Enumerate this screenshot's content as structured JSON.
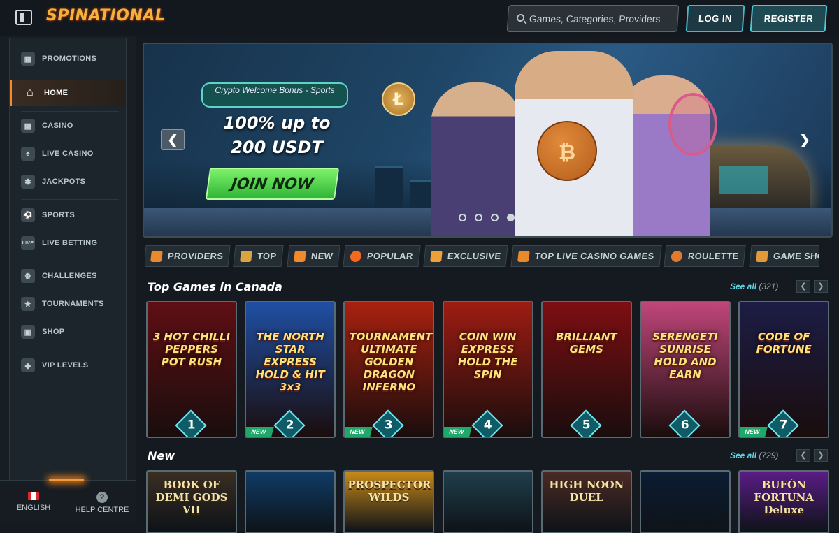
{
  "header": {
    "logo": "SPINATIONAL",
    "search_placeholder": "Games, Categories, Providers",
    "login": "LOG IN",
    "register": "REGISTER"
  },
  "sidebar": {
    "items": [
      {
        "label": "PROMOTIONS",
        "icon": "gift-icon",
        "active": false
      },
      {
        "label": "HOME",
        "icon": "home-icon",
        "active": true
      },
      {
        "label": "CASINO",
        "icon": "slot-machine-icon",
        "active": false
      },
      {
        "label": "LIVE CASINO",
        "icon": "cards-icon",
        "active": false
      },
      {
        "label": "JACKPOTS",
        "icon": "jackpot-icon",
        "active": false
      },
      {
        "label": "SPORTS",
        "icon": "soccer-ball-icon",
        "active": false
      },
      {
        "label": "LIVE BETTING",
        "icon": "live-icon",
        "active": false
      },
      {
        "label": "CHALLENGES",
        "icon": "challenge-icon",
        "active": false
      },
      {
        "label": "TOURNAMENTS",
        "icon": "tournament-icon",
        "active": false
      },
      {
        "label": "SHOP",
        "icon": "shop-bag-icon",
        "active": false
      },
      {
        "label": "VIP LEVELS",
        "icon": "diamond-icon",
        "active": false
      }
    ],
    "language": "ENGLISH",
    "help": "HELP CENTRE"
  },
  "hero": {
    "badge": "Crypto Welcome Bonus - Sports",
    "offer_line1": "100% up to",
    "offer_line2": "200 USDT",
    "cta": "JOIN NOW",
    "slides": 4,
    "active_slide": 4
  },
  "categories": [
    {
      "label": "PROVIDERS",
      "color": "#e8892c"
    },
    {
      "label": "TOP",
      "color": "#d9a441"
    },
    {
      "label": "NEW",
      "color": "#f08a2a"
    },
    {
      "label": "POPULAR",
      "color": "#f06a22"
    },
    {
      "label": "EXCLUSIVE",
      "color": "#f0a03a"
    },
    {
      "label": "TOP LIVE CASINO GAMES",
      "color": "#e8892c"
    },
    {
      "label": "ROULETTE",
      "color": "#e07a2e"
    },
    {
      "label": "GAME SHOWS",
      "color": "#e09a3a"
    }
  ],
  "top_games": {
    "title": "Top Games in Canada",
    "see_all": "See all",
    "count": "(321)",
    "games": [
      {
        "name": "3 HOT CHILLI PEPPERS POT RUSH",
        "rank": "1",
        "new": false,
        "bg": "#5e0f14"
      },
      {
        "name": "THE NORTH STAR EXPRESS HOLD & HIT 3x3",
        "rank": "2",
        "new": true,
        "bg": "#1f4fa3"
      },
      {
        "name": "TOURNAMENT ULTIMATE GOLDEN DRAGON INFERNO",
        "rank": "3",
        "new": true,
        "bg": "#a8210f"
      },
      {
        "name": "COIN WIN EXPRESS HOLD THE SPIN",
        "rank": "4",
        "new": true,
        "bg": "#9d1c12"
      },
      {
        "name": "BRILLIANT GEMS",
        "rank": "5",
        "new": false,
        "bg": "#7d0e12"
      },
      {
        "name": "SERENGETI SUNRISE HOLD AND EARN",
        "rank": "6",
        "new": false,
        "bg": "#c0467a"
      },
      {
        "name": "CODE OF FORTUNE",
        "rank": "7",
        "new": true,
        "bg": "#1c1d45"
      }
    ]
  },
  "new_games": {
    "title": "New",
    "see_all": "See all",
    "count": "(729)",
    "games": [
      {
        "name": "BOOK OF DEMI GODS VII",
        "bg": "#3a2e22"
      },
      {
        "name": "",
        "bg": "#0f3b66"
      },
      {
        "name": "PROSPECTOR WILDS",
        "bg": "#c98a18"
      },
      {
        "name": "",
        "bg": "#1f3e4c"
      },
      {
        "name": "HIGH NOON DUEL",
        "bg": "#4a2a24"
      },
      {
        "name": "",
        "bg": "#0c1c33"
      },
      {
        "name": "BUFÓN FORTUNA Deluxe",
        "bg": "#5a1c86"
      }
    ]
  }
}
